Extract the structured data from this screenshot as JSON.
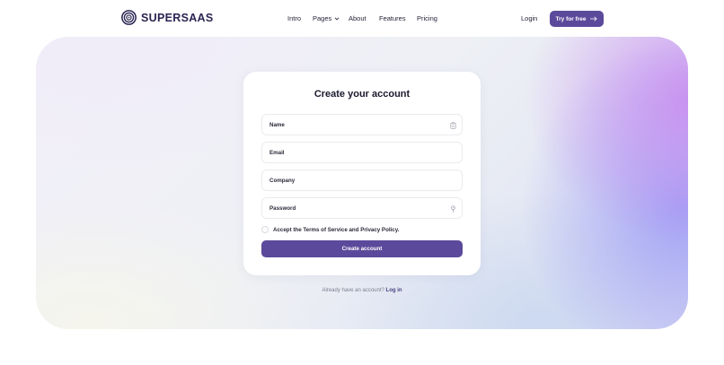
{
  "brand": {
    "name": "SUPERSAAS",
    "logo_icon": "concentric-circles-logo-icon",
    "color": "#2a2553"
  },
  "nav": {
    "links": [
      "Intro",
      "Pages",
      "About",
      "Features",
      "Pricing"
    ],
    "pages_chevron_icon": "chevron-down-icon",
    "login_label": "Login",
    "cta_label": "Try for free",
    "cta_icon": "arrow-right-icon"
  },
  "signup": {
    "title": "Create your account",
    "fields": {
      "name_placeholder": "Name",
      "email_placeholder": "Email",
      "company_placeholder": "Company",
      "password_placeholder": "Password"
    },
    "name_field_icon": "clipboard-icon",
    "password_field_icon": "key-icon",
    "terms_label": "Accept the Terms of Service and Privacy Policy.",
    "submit_label": "Create account"
  },
  "footer_prompt": {
    "text": "Already have an account?",
    "link": "Log in"
  },
  "colors": {
    "accent": "#5b4a9b",
    "hero_glow_pink": "#c88cf0",
    "hero_glow_blue": "#9696f5"
  }
}
